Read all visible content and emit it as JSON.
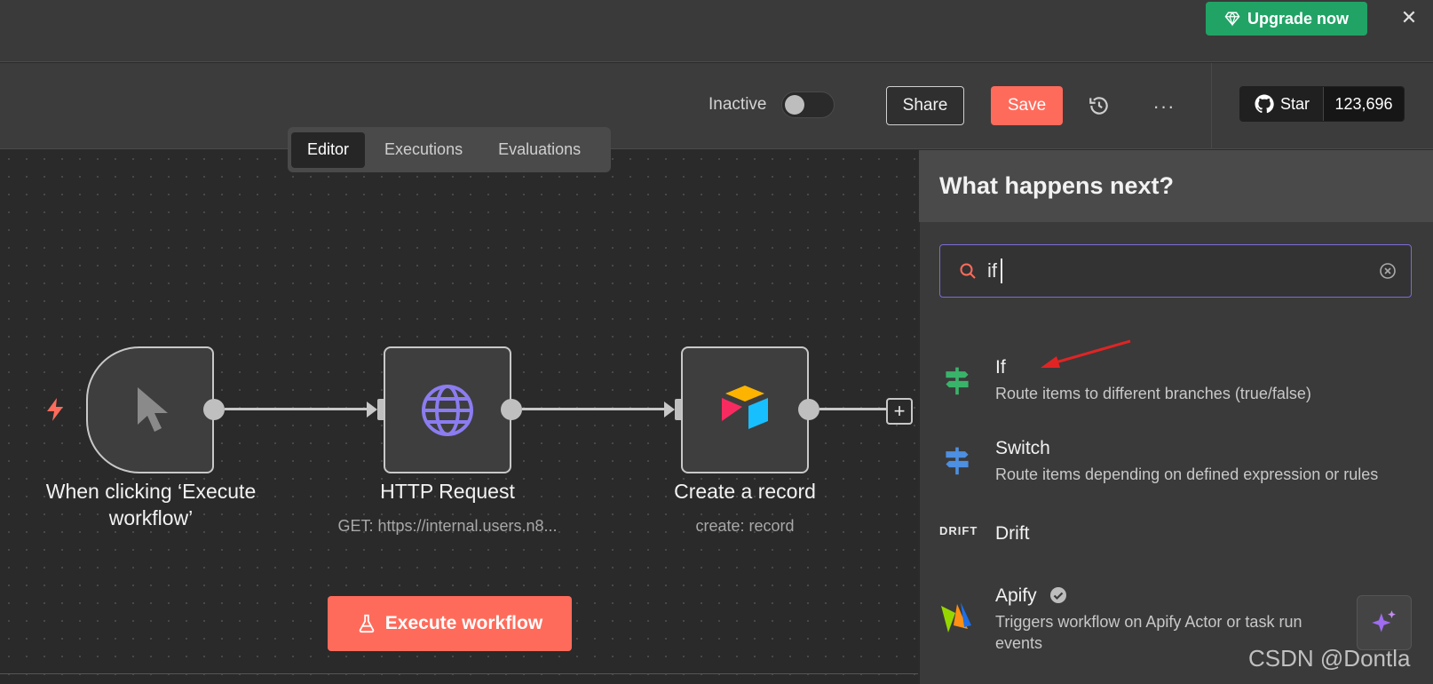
{
  "topbar": {
    "upgrade_label": "Upgrade now",
    "close_glyph": "✕"
  },
  "header": {
    "status_label": "Inactive",
    "share_label": "Share",
    "save_label": "Save",
    "more_glyph": "···",
    "github": {
      "star_label": "Star",
      "star_count": "123,696"
    }
  },
  "tabs": [
    {
      "label": "Editor",
      "active": true
    },
    {
      "label": "Executions",
      "active": false
    },
    {
      "label": "Evaluations",
      "active": false
    }
  ],
  "canvas": {
    "nodes": [
      {
        "title_line1": "When clicking ‘Execute",
        "title_line2": "workflow’",
        "subtitle": "",
        "icon": "cursor-icon"
      },
      {
        "title": "HTTP Request",
        "subtitle": "GET: https://internal.users.n8...",
        "icon": "globe-icon"
      },
      {
        "title": "Create a record",
        "subtitle": "create: record",
        "icon": "airtable-icon"
      }
    ],
    "add_glyph": "+",
    "execute_label": "Execute workflow"
  },
  "panel": {
    "title": "What happens next?",
    "search_value": "if",
    "results": [
      {
        "title": "If",
        "description": "Route items to different branches (true/false)",
        "icon": "if-signpost-icon",
        "icon_color": "#3ab36a"
      },
      {
        "title": "Switch",
        "description": "Route items depending on defined expression or rules",
        "icon": "switch-signpost-icon",
        "icon_color": "#4d8fe0"
      },
      {
        "title": "Drift",
        "description": "",
        "icon": "drift-logo-icon",
        "icon_text": "DRIFT"
      },
      {
        "title": "Apify",
        "description_line1": "Triggers workflow on Apify Actor or task run",
        "description_line2": "events",
        "icon": "apify-logo-icon"
      }
    ]
  },
  "watermark": "CSDN @Dontla",
  "colors": {
    "accent": "#ff6b5b",
    "upgrade": "#21a366",
    "search_border": "#7c6bd8"
  }
}
